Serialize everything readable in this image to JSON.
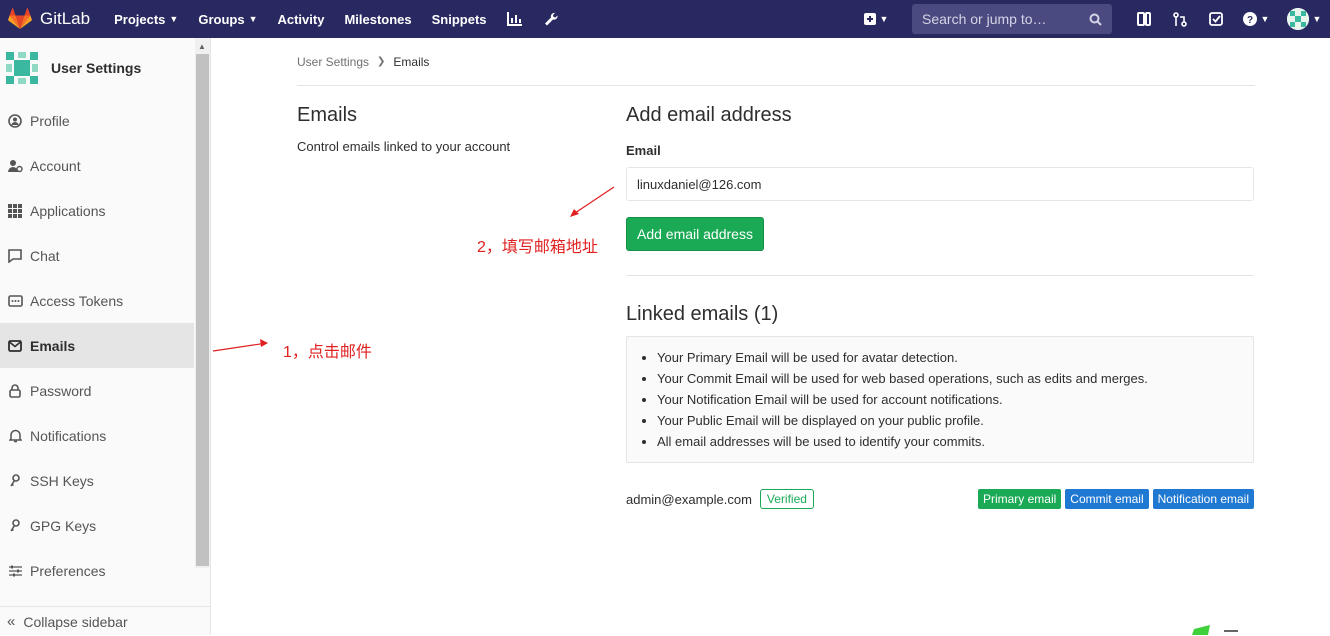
{
  "topbar": {
    "brand": "GitLab",
    "nav": [
      {
        "label": "Projects",
        "dropdown": true
      },
      {
        "label": "Groups",
        "dropdown": true
      },
      {
        "label": "Activity",
        "dropdown": false
      },
      {
        "label": "Milestones",
        "dropdown": false
      },
      {
        "label": "Snippets",
        "dropdown": false
      }
    ],
    "search_placeholder": "Search or jump to…"
  },
  "sidebar": {
    "title": "User Settings",
    "items": [
      {
        "label": "Profile",
        "icon": "profile-icon",
        "active": false
      },
      {
        "label": "Account",
        "icon": "account-icon",
        "active": false
      },
      {
        "label": "Applications",
        "icon": "applications-icon",
        "active": false
      },
      {
        "label": "Chat",
        "icon": "chat-icon",
        "active": false
      },
      {
        "label": "Access Tokens",
        "icon": "access-tokens-icon",
        "active": false
      },
      {
        "label": "Emails",
        "icon": "mail-icon",
        "active": true
      },
      {
        "label": "Password",
        "icon": "lock-icon",
        "active": false
      },
      {
        "label": "Notifications",
        "icon": "bell-icon",
        "active": false
      },
      {
        "label": "SSH Keys",
        "icon": "key-icon",
        "active": false
      },
      {
        "label": "GPG Keys",
        "icon": "key-icon",
        "active": false
      },
      {
        "label": "Preferences",
        "icon": "sliders-icon",
        "active": false
      }
    ],
    "collapse_label": "Collapse sidebar"
  },
  "breadcrumb": {
    "parent": "User Settings",
    "current": "Emails"
  },
  "left": {
    "title": "Emails",
    "description": "Control emails linked to your account"
  },
  "form": {
    "title": "Add email address",
    "email_label": "Email",
    "email_value": "linuxdaniel@126.com",
    "submit_label": "Add email address"
  },
  "linked": {
    "title": "Linked emails (1)",
    "notes": [
      "Your Primary Email will be used for avatar detection.",
      "Your Commit Email will be used for web based operations, such as edits and merges.",
      "Your Notification Email will be used for account notifications.",
      "Your Public Email will be displayed on your public profile.",
      "All email addresses will be used to identify your commits."
    ],
    "email": "admin@example.com",
    "verified_label": "Verified",
    "badges": [
      {
        "label": "Primary email",
        "color": "#1aaa55"
      },
      {
        "label": "Commit email",
        "color": "#1f78d1"
      },
      {
        "label": "Notification email",
        "color": "#1f78d1"
      }
    ]
  },
  "annotations": {
    "step1": "1，点击邮件",
    "step2": "2，填写邮箱地址",
    "color": "#e02020"
  }
}
